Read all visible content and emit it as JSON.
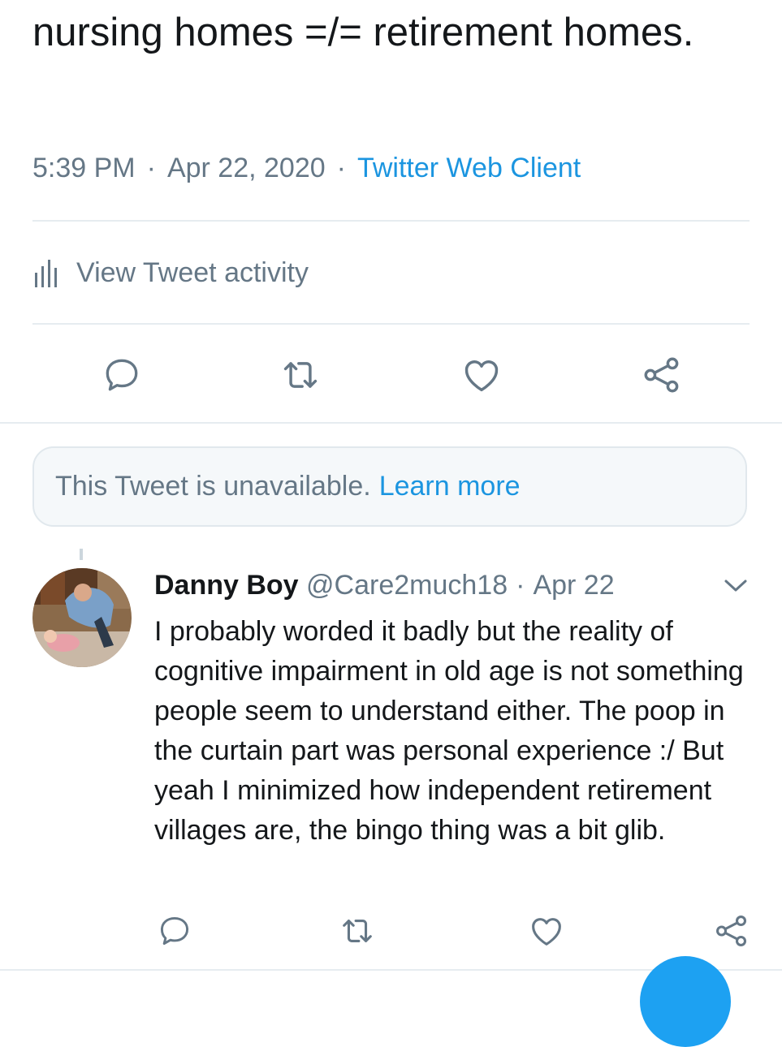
{
  "tweet": {
    "text": "nursing homes =/= retirement homes.",
    "time": "5:39 PM",
    "separator": "·",
    "date": "Apr 22, 2020",
    "client": "Twitter Web Client"
  },
  "activity": {
    "label": "View Tweet activity",
    "icon": "bar-chart-icon"
  },
  "actions": [
    "reply-icon",
    "retweet-icon",
    "like-icon",
    "share-icon"
  ],
  "unavailable": {
    "text": "This Tweet is unavailable.",
    "link": "Learn more"
  },
  "reply": {
    "name": "Danny Boy",
    "handle": "@Care2much18",
    "separator": "·",
    "date": "Apr 22",
    "text": "I probably worded it badly but the reality of cognitive impairment in old age is not something people seem to understand either. The poop in the curtain part was personal experience :/ But yeah I minimized how independent retirement villages are, the bingo thing was a bit glib."
  },
  "colors": {
    "accent": "#1b95e0",
    "muted_text": "#657786",
    "divider": "#e6ecf0",
    "fab": "#1da1f2"
  }
}
